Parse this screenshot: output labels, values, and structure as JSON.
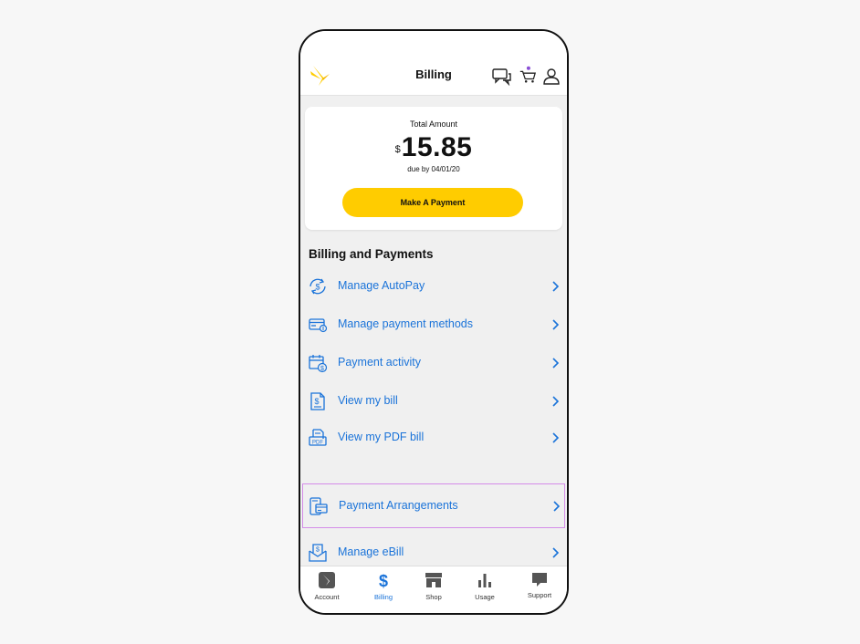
{
  "header": {
    "title": "Billing",
    "icons": [
      "sprint-logo-icon",
      "chat-icon",
      "cart-icon",
      "profile-icon"
    ],
    "cart_badge_color": "#8a4fd6"
  },
  "balance": {
    "label": "Total Amount",
    "currency": "$",
    "amount": "15.85",
    "due": "due by 04/01/20",
    "button": "Make A Payment",
    "button_color": "#ffcc00"
  },
  "billing": {
    "section_title": "Billing and Payments",
    "items": [
      {
        "label": "Manage AutoPay",
        "icon": "autopay-icon"
      },
      {
        "label": "Manage payment methods",
        "icon": "credit-card-icon"
      },
      {
        "label": "Payment activity",
        "icon": "calendar-dollar-icon"
      },
      {
        "label": "View my bill",
        "icon": "bill-document-icon"
      },
      {
        "label": "View my PDF bill",
        "icon": "pdf-bill-icon"
      },
      {
        "label": "Payment Arrangements",
        "icon": "payment-arrangements-icon",
        "highlighted": true
      },
      {
        "label": "Manage eBill",
        "icon": "ebill-envelope-icon"
      }
    ],
    "link_color": "#1a73d9",
    "highlight_color": "#d48ce8"
  },
  "tabs": [
    {
      "label": "Account",
      "icon": "account-icon"
    },
    {
      "label": "Billing",
      "icon": "dollar-icon",
      "active": true
    },
    {
      "label": "Shop",
      "icon": "shop-icon"
    },
    {
      "label": "Usage",
      "icon": "usage-bars-icon"
    },
    {
      "label": "Support",
      "icon": "support-chat-icon"
    }
  ]
}
